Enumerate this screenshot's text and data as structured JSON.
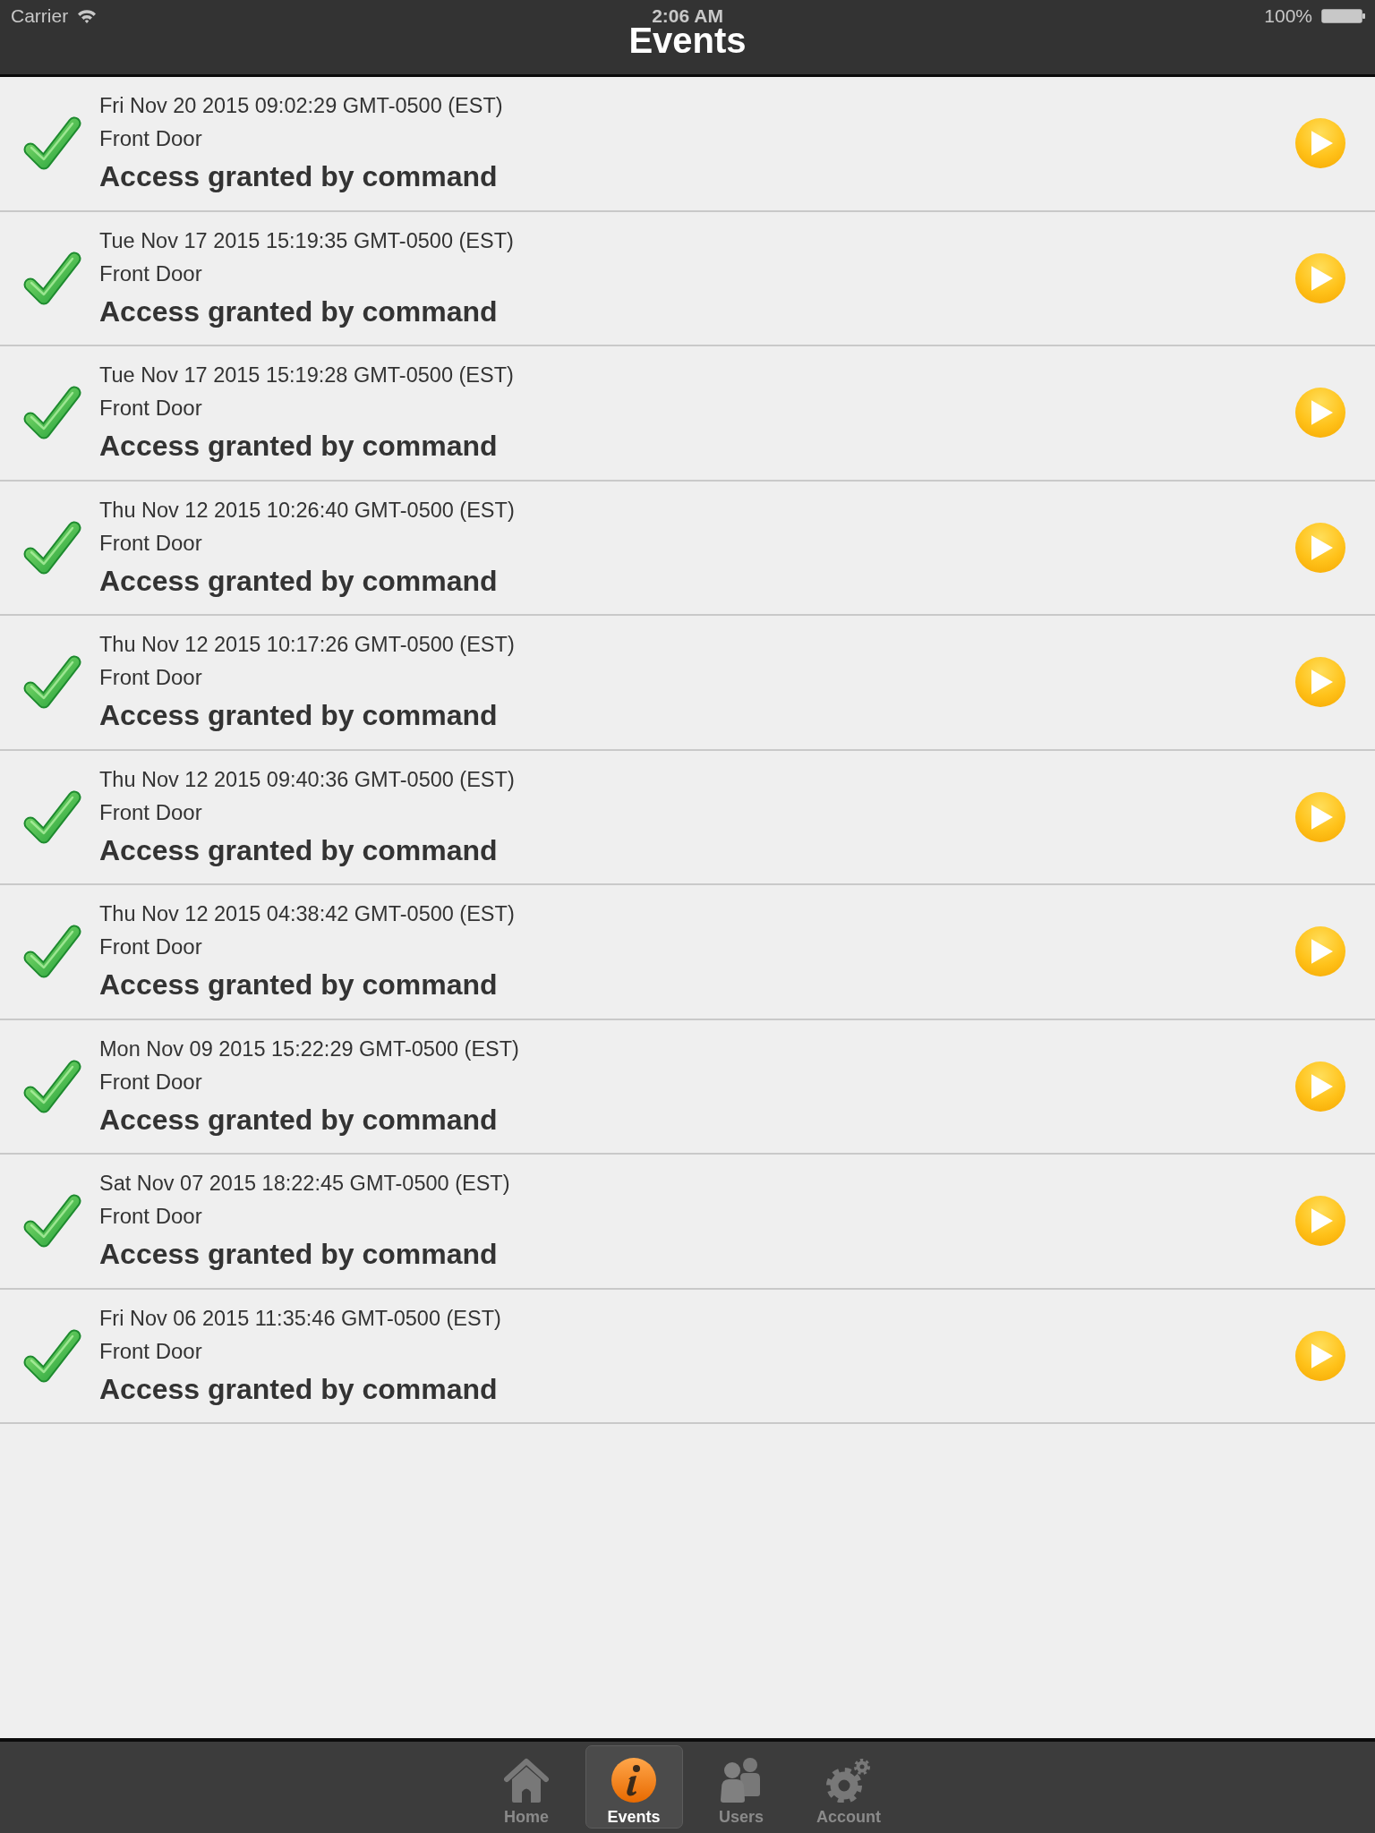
{
  "status_bar": {
    "carrier": "Carrier",
    "time": "2:06 AM",
    "battery": "100%"
  },
  "nav_bar": {
    "title": "Events"
  },
  "events": [
    {
      "date": "Fri Nov 20 2015 09:02:29 GMT-0500 (EST)",
      "location": "Front Door",
      "message": "Access granted by command"
    },
    {
      "date": "Tue Nov 17 2015 15:19:35 GMT-0500 (EST)",
      "location": "Front Door",
      "message": "Access granted by command"
    },
    {
      "date": "Tue Nov 17 2015 15:19:28 GMT-0500 (EST)",
      "location": "Front Door",
      "message": "Access granted by command"
    },
    {
      "date": "Thu Nov 12 2015 10:26:40 GMT-0500 (EST)",
      "location": "Front Door",
      "message": "Access granted by command"
    },
    {
      "date": "Thu Nov 12 2015 10:17:26 GMT-0500 (EST)",
      "location": "Front Door",
      "message": "Access granted by command"
    },
    {
      "date": "Thu Nov 12 2015 09:40:36 GMT-0500 (EST)",
      "location": "Front Door",
      "message": "Access granted by command"
    },
    {
      "date": "Thu Nov 12 2015 04:38:42 GMT-0500 (EST)",
      "location": "Front Door",
      "message": "Access granted by command"
    },
    {
      "date": "Mon Nov 09 2015 15:22:29 GMT-0500 (EST)",
      "location": "Front Door",
      "message": "Access granted by command"
    },
    {
      "date": "Sat Nov 07 2015 18:22:45 GMT-0500 (EST)",
      "location": "Front Door",
      "message": "Access granted by command"
    },
    {
      "date": "Fri Nov 06 2015 11:35:46 GMT-0500 (EST)",
      "location": "Front Door",
      "message": "Access granted by command"
    }
  ],
  "tab_bar": [
    {
      "label": "Home",
      "kind": "home",
      "selected": false
    },
    {
      "label": "Events",
      "kind": "info",
      "selected": true
    },
    {
      "label": "Users",
      "kind": "users",
      "selected": false
    },
    {
      "label": "Account",
      "kind": "gear",
      "selected": false
    }
  ]
}
